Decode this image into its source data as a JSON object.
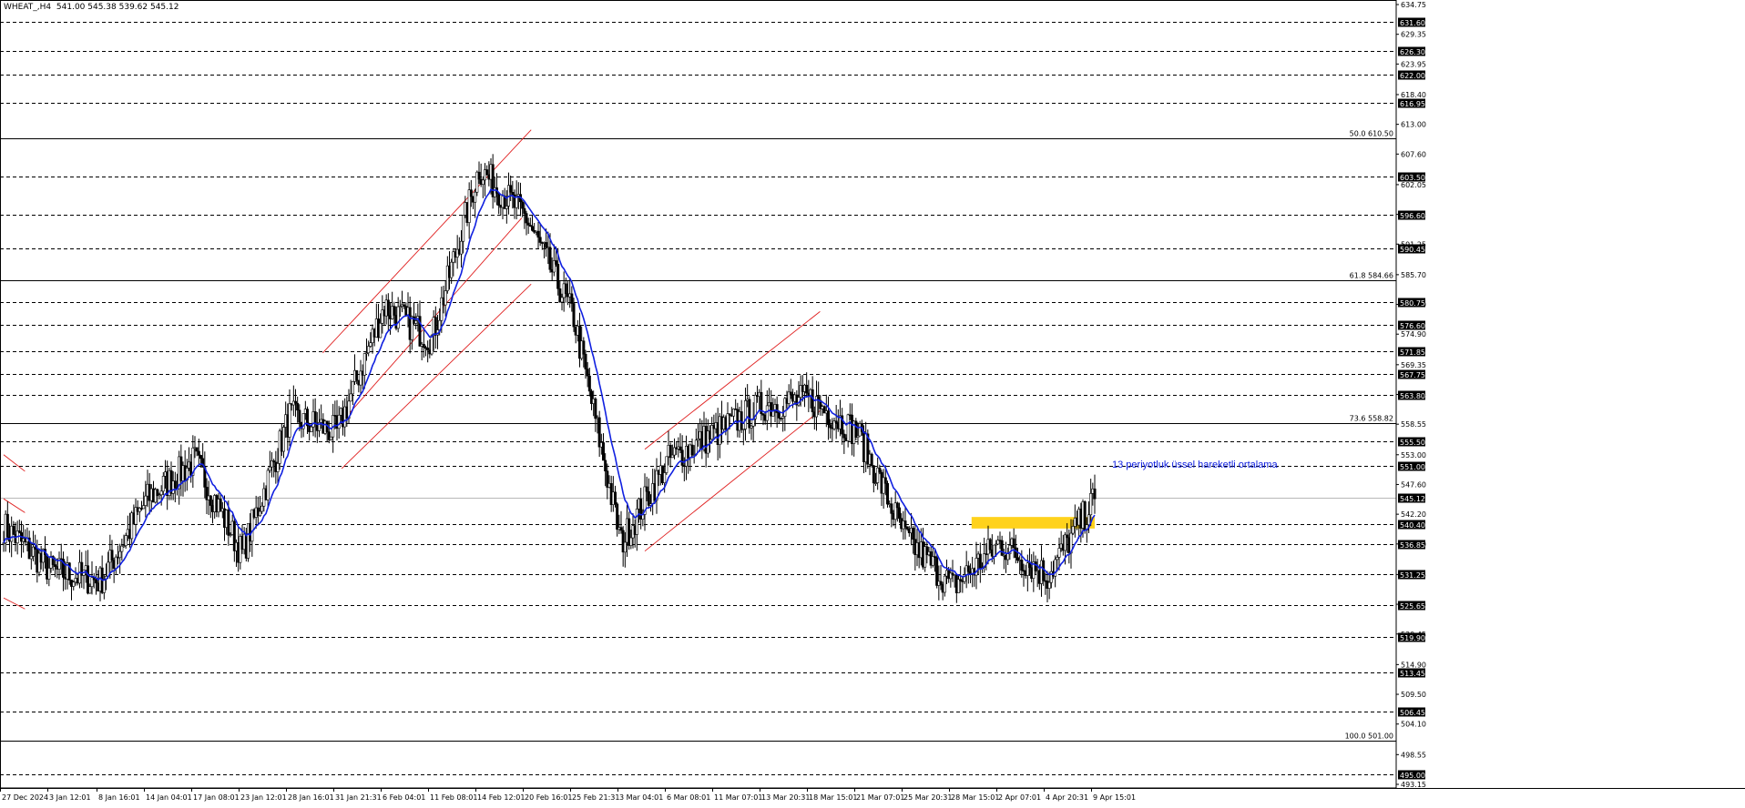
{
  "header": {
    "symbol_timeframe": "WHEAT_,H4",
    "ohlc": "541.00 545.38 539.62 545.12"
  },
  "colors": {
    "candle": "#000000",
    "ema": "#1020e0",
    "channel": "#e02020",
    "zone": "#ffd21c",
    "grid": "#000000"
  },
  "chart_data": {
    "type": "candlestick",
    "title": "WHEAT_,H4",
    "ylim": [
      493.15,
      634.75
    ],
    "grid": true,
    "y_tick_labels": [
      "634.75",
      "629.35",
      "623.95",
      "618.40",
      "613.00",
      "607.60",
      "602.05",
      "596.65",
      "591.25",
      "585.70",
      "580.30",
      "574.90",
      "569.35",
      "563.95",
      "558.55",
      "553.00",
      "547.60",
      "542.20",
      "536.80",
      "531.25",
      "525.85",
      "520.45",
      "514.90",
      "509.50",
      "504.10",
      "498.55",
      "493.15"
    ],
    "x_tick_labels": [
      "27 Dec 2024",
      "3 Jan 12:01",
      "8 Jan 16:01",
      "14 Jan 04:01",
      "17 Jan 08:01",
      "23 Jan 12:01",
      "28 Jan 16:01",
      "31 Jan 21:31",
      "6 Feb 04:01",
      "11 Feb 08:01",
      "14 Feb 12:01",
      "20 Feb 16:01",
      "25 Feb 21:31",
      "3 Mar 04:01",
      "6 Mar 08:01",
      "11 Mar 07:01",
      "13 Mar 20:31",
      "18 Mar 15:01",
      "21 Mar 07:01",
      "25 Mar 20:31",
      "28 Mar 15:01",
      "2 Apr 07:01",
      "4 Apr 20:31",
      "9 Apr 15:01"
    ],
    "horizontal_levels": [
      {
        "price": 631.6,
        "label": "631.60"
      },
      {
        "price": 626.3,
        "label": "626.30"
      },
      {
        "price": 622.0,
        "label": "622.00"
      },
      {
        "price": 616.95,
        "label": "616.95"
      },
      {
        "price": 603.5,
        "label": "603.50"
      },
      {
        "price": 596.6,
        "label": "596.60"
      },
      {
        "price": 590.45,
        "label": "590.45"
      },
      {
        "price": 580.75,
        "label": "580.75"
      },
      {
        "price": 576.6,
        "label": "576.60"
      },
      {
        "price": 571.85,
        "label": "571.85"
      },
      {
        "price": 567.75,
        "label": "567.75"
      },
      {
        "price": 563.8,
        "label": "563.80"
      },
      {
        "price": 555.5,
        "label": "555.50"
      },
      {
        "price": 551.0,
        "label": "551.00"
      },
      {
        "price": 540.4,
        "label": "540.40"
      },
      {
        "price": 536.85,
        "label": "536.85"
      },
      {
        "price": 531.25,
        "label": "531.25"
      },
      {
        "price": 525.65,
        "label": "525.65"
      },
      {
        "price": 519.9,
        "label": "519.90"
      },
      {
        "price": 513.45,
        "label": "513.45"
      },
      {
        "price": 506.45,
        "label": "506.45"
      },
      {
        "price": 495.0,
        "label": "495.00"
      }
    ],
    "fibonacci_levels": [
      {
        "price": 610.5,
        "label": "50.0 610.50"
      },
      {
        "price": 584.66,
        "label": "61.8 584.66"
      },
      {
        "price": 558.82,
        "label": "73.6 558.82"
      },
      {
        "price": 501.0,
        "label": "100.0 501.00"
      }
    ],
    "current_price": {
      "price": 545.12,
      "label": "545.12"
    },
    "zone": {
      "low": 539.6,
      "high": 541.7
    },
    "ema_period": 13,
    "annotation": "13 periyotluk üssel hareketli ortalama",
    "key_points": [
      {
        "x": "27 Dec 2024",
        "close": 540
      },
      {
        "x": "3 Jan 12:01",
        "close": 532
      },
      {
        "x": "8 Jan 16:01",
        "close": 530
      },
      {
        "x": "14 Jan 04:01",
        "close": 545
      },
      {
        "x": "17 Jan 08:01",
        "close": 552
      },
      {
        "x": "23 Jan 12:01",
        "close": 535
      },
      {
        "x": "28 Jan 16:01",
        "close": 560
      },
      {
        "x": "31 Jan 21:31",
        "close": 557
      },
      {
        "x": "6 Feb 04:01",
        "close": 580
      },
      {
        "x": "11 Feb 08:01",
        "close": 574
      },
      {
        "x": "14 Feb 12:01",
        "close": 605
      },
      {
        "x": "20 Feb 16:01",
        "close": 596
      },
      {
        "x": "25 Feb 21:31",
        "close": 578
      },
      {
        "x": "3 Mar 04:01",
        "close": 537
      },
      {
        "x": "6 Mar 08:01",
        "close": 552
      },
      {
        "x": "11 Mar 07:01",
        "close": 557
      },
      {
        "x": "13 Mar 20:31",
        "close": 562
      },
      {
        "x": "18 Mar 15:01",
        "close": 563
      },
      {
        "x": "21 Mar 07:01",
        "close": 557
      },
      {
        "x": "25 Mar 20:31",
        "close": 538
      },
      {
        "x": "28 Mar 15:01",
        "close": 529
      },
      {
        "x": "2 Apr 07:01",
        "close": 537
      },
      {
        "x": "4 Apr 20:31",
        "close": 531
      },
      {
        "x": "9 Apr 15:01",
        "close": 545
      }
    ]
  }
}
